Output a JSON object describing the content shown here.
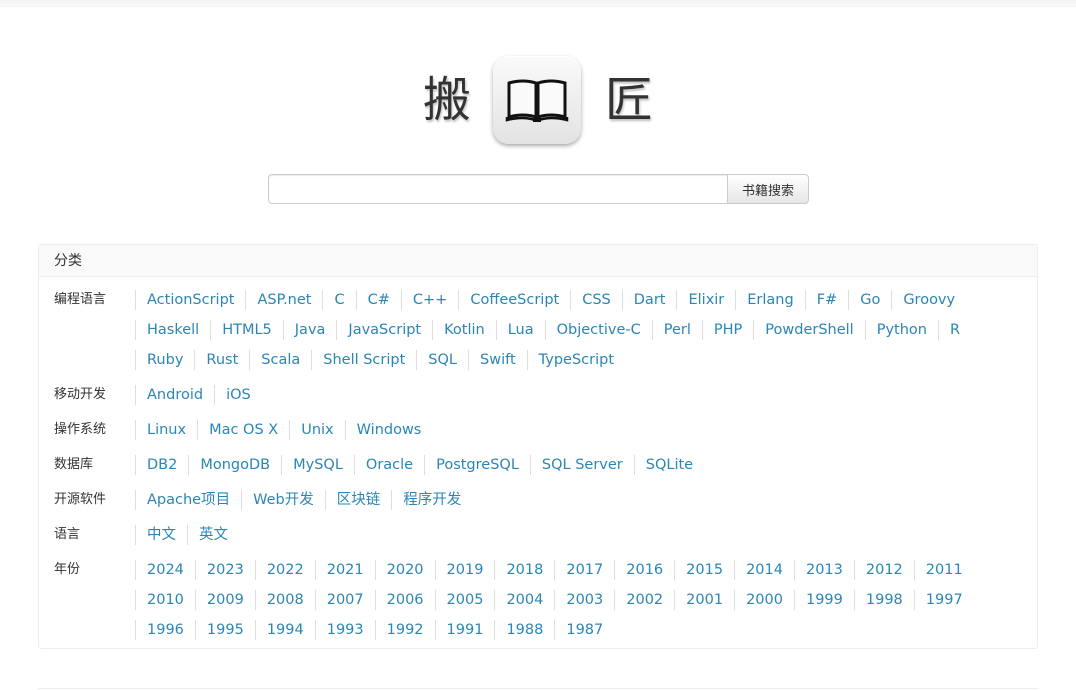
{
  "logo": {
    "left_char": "搬",
    "right_char": "匠",
    "icon": "open-book-icon"
  },
  "search": {
    "value": "",
    "placeholder": "",
    "button_label": "书籍搜索"
  },
  "panel": {
    "title": "分类",
    "categories": [
      {
        "label": "编程语言",
        "links": [
          "ActionScript",
          "ASP.net",
          "C",
          "C#",
          "C++",
          "CoffeeScript",
          "CSS",
          "Dart",
          "Elixir",
          "Erlang",
          "F#",
          "Go",
          "Groovy",
          "Haskell",
          "HTML5",
          "Java",
          "JavaScript",
          "Kotlin",
          "Lua",
          "Objective-C",
          "Perl",
          "PHP",
          "PowderShell",
          "Python",
          "R",
          "Ruby",
          "Rust",
          "Scala",
          "Shell Script",
          "SQL",
          "Swift",
          "TypeScript"
        ]
      },
      {
        "label": "移动开发",
        "links": [
          "Android",
          "iOS"
        ]
      },
      {
        "label": "操作系统",
        "links": [
          "Linux",
          "Mac OS X",
          "Unix",
          "Windows"
        ]
      },
      {
        "label": "数据库",
        "links": [
          "DB2",
          "MongoDB",
          "MySQL",
          "Oracle",
          "PostgreSQL",
          "SQL Server",
          "SQLite"
        ]
      },
      {
        "label": "开源软件",
        "links": [
          "Apache项目",
          "Web开发",
          "区块链",
          "程序开发"
        ]
      },
      {
        "label": "语言",
        "links": [
          "中文",
          "英文"
        ]
      },
      {
        "label": "年份",
        "links": [
          "2024",
          "2023",
          "2022",
          "2021",
          "2020",
          "2019",
          "2018",
          "2017",
          "2016",
          "2015",
          "2014",
          "2013",
          "2012",
          "2011",
          "2010",
          "2009",
          "2008",
          "2007",
          "2006",
          "2005",
          "2004",
          "2003",
          "2002",
          "2001",
          "2000",
          "1999",
          "1998",
          "1997",
          "1996",
          "1995",
          "1994",
          "1993",
          "1992",
          "1991",
          "1988",
          "1987"
        ]
      }
    ]
  },
  "colors": {
    "link": "#2a86b6",
    "text": "#333333",
    "border": "#eeeeee"
  }
}
